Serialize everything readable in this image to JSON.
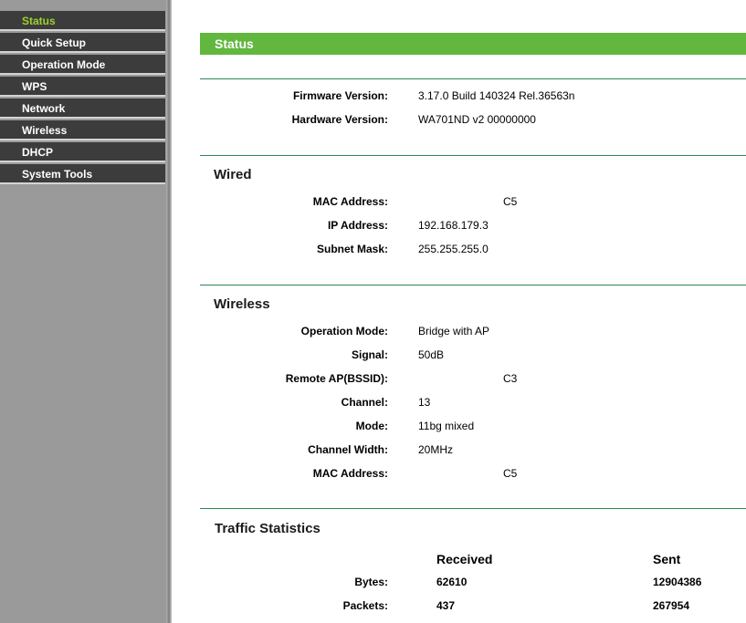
{
  "sidebar": {
    "items": [
      {
        "label": "Status",
        "active": true
      },
      {
        "label": "Quick Setup",
        "active": false
      },
      {
        "label": "Operation Mode",
        "active": false
      },
      {
        "label": "WPS",
        "active": false
      },
      {
        "label": "Network",
        "active": false
      },
      {
        "label": "Wireless",
        "active": false
      },
      {
        "label": "DHCP",
        "active": false
      },
      {
        "label": "System Tools",
        "active": false
      }
    ]
  },
  "header": {
    "title": "Status"
  },
  "info": {
    "firmware_label": "Firmware Version:",
    "firmware_value": "3.17.0 Build 140324 Rel.36563n",
    "hardware_label": "Hardware Version:",
    "hardware_value": "WA701ND v2 00000000"
  },
  "wired": {
    "title": "Wired",
    "mac_label": "MAC Address:",
    "mac_value": "C5",
    "ip_label": "IP Address:",
    "ip_value": "192.168.179.3",
    "mask_label": "Subnet Mask:",
    "mask_value": "255.255.255.0"
  },
  "wireless": {
    "title": "Wireless",
    "opmode_label": "Operation Mode:",
    "opmode_value": "Bridge with AP",
    "signal_label": "Signal:",
    "signal_value": "50dB",
    "remote_label": "Remote AP(BSSID):",
    "remote_value": "C3",
    "channel_label": "Channel:",
    "channel_value": "13",
    "mode_label": "Mode:",
    "mode_value": "11bg mixed",
    "width_label": "Channel Width:",
    "width_value": "20MHz",
    "mac_label": "MAC Address:",
    "mac_value": "C5"
  },
  "traffic": {
    "title": "Traffic Statistics",
    "received_label": "Received",
    "sent_label": "Sent",
    "bytes_label": "Bytes:",
    "bytes_received": "62610",
    "bytes_sent": "12904386",
    "packets_label": "Packets:",
    "packets_received": "437",
    "packets_sent": "267954"
  },
  "colors": {
    "accent": "#62b73e",
    "active_menu": "#9cd22e",
    "menu_bg": "#3c3c3c",
    "divider": "#2a8a55"
  }
}
